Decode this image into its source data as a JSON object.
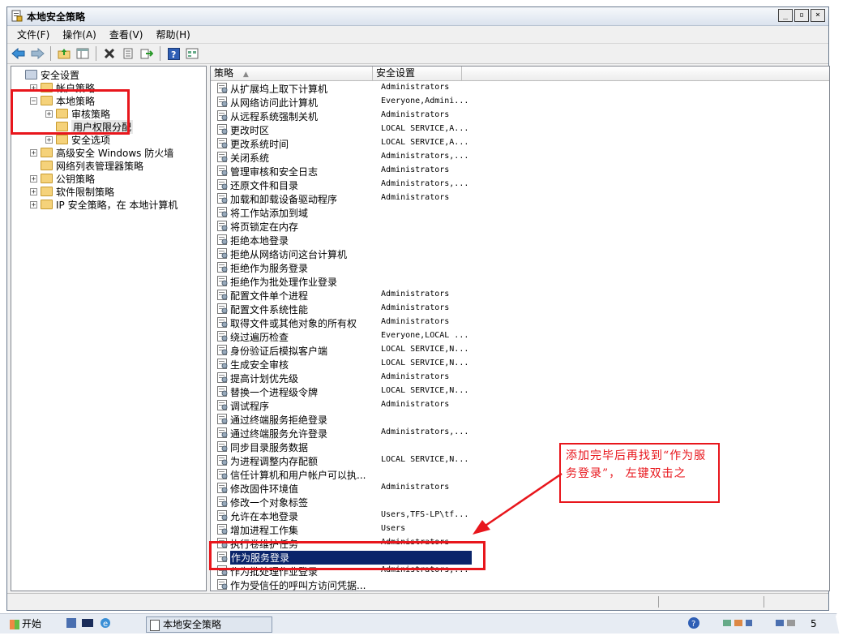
{
  "window": {
    "title": "本地安全策略"
  },
  "title_buttons": [
    "_",
    "▫",
    "×"
  ],
  "menu": [
    "文件(F)",
    "操作(A)",
    "查看(V)",
    "帮助(H)"
  ],
  "toolbar_icons": [
    "back-icon",
    "forward-icon",
    "up-folder-icon",
    "show-tree-icon",
    "delete-icon",
    "properties-icon",
    "export-icon",
    "help-icon",
    "view-icon"
  ],
  "tree": [
    {
      "label": "安全设置",
      "level": 0,
      "exp": ""
    },
    {
      "label": "帐户策略",
      "level": 1,
      "exp": "+"
    },
    {
      "label": "本地策略",
      "level": 1,
      "exp": "−"
    },
    {
      "label": "审核策略",
      "level": 2,
      "exp": "+"
    },
    {
      "label": "用户权限分配",
      "level": 2,
      "exp": ""
    },
    {
      "label": "安全选项",
      "level": 2,
      "exp": "+"
    },
    {
      "label": "高级安全 Windows 防火墙",
      "level": 1,
      "exp": "+"
    },
    {
      "label": "网络列表管理器策略",
      "level": 1,
      "exp": ""
    },
    {
      "label": "公钥策略",
      "level": 1,
      "exp": "+"
    },
    {
      "label": "软件限制策略",
      "level": 1,
      "exp": "+"
    },
    {
      "label": "IP 安全策略，在 本地计算机",
      "level": 1,
      "exp": "+"
    }
  ],
  "columns": [
    "策略",
    "安全设置"
  ],
  "policies": [
    {
      "name": "从扩展坞上取下计算机",
      "value": "Administrators"
    },
    {
      "name": "从网络访问此计算机",
      "value": "Everyone,Admini..."
    },
    {
      "name": "从远程系统强制关机",
      "value": "Administrators"
    },
    {
      "name": "更改时区",
      "value": "LOCAL SERVICE,A..."
    },
    {
      "name": "更改系统时间",
      "value": "LOCAL SERVICE,A..."
    },
    {
      "name": "关闭系统",
      "value": "Administrators,..."
    },
    {
      "name": "管理审核和安全日志",
      "value": "Administrators"
    },
    {
      "name": "还原文件和目录",
      "value": "Administrators,..."
    },
    {
      "name": "加载和卸载设备驱动程序",
      "value": "Administrators"
    },
    {
      "name": "将工作站添加到域",
      "value": ""
    },
    {
      "name": "将页锁定在内存",
      "value": ""
    },
    {
      "name": "拒绝本地登录",
      "value": ""
    },
    {
      "name": "拒绝从网络访问这台计算机",
      "value": ""
    },
    {
      "name": "拒绝作为服务登录",
      "value": ""
    },
    {
      "name": "拒绝作为批处理作业登录",
      "value": ""
    },
    {
      "name": "配置文件单个进程",
      "value": "Administrators"
    },
    {
      "name": "配置文件系统性能",
      "value": "Administrators"
    },
    {
      "name": "取得文件或其他对象的所有权",
      "value": "Administrators"
    },
    {
      "name": "绕过遍历检查",
      "value": "Everyone,LOCAL ..."
    },
    {
      "name": "身份验证后模拟客户端",
      "value": "LOCAL SERVICE,N..."
    },
    {
      "name": "生成安全审核",
      "value": "LOCAL SERVICE,N..."
    },
    {
      "name": "提高计划优先级",
      "value": "Administrators"
    },
    {
      "name": "替换一个进程级令牌",
      "value": "LOCAL SERVICE,N..."
    },
    {
      "name": "调试程序",
      "value": "Administrators"
    },
    {
      "name": "通过终端服务拒绝登录",
      "value": ""
    },
    {
      "name": "通过终端服务允许登录",
      "value": "Administrators,..."
    },
    {
      "name": "同步目录服务数据",
      "value": ""
    },
    {
      "name": "为进程调整内存配额",
      "value": "LOCAL SERVICE,N..."
    },
    {
      "name": "信任计算机和用户帐户可以执...",
      "value": ""
    },
    {
      "name": "修改固件环境值",
      "value": "Administrators"
    },
    {
      "name": "修改一个对象标签",
      "value": ""
    },
    {
      "name": "允许在本地登录",
      "value": "Users,TFS-LP\\tf..."
    },
    {
      "name": "增加进程工作集",
      "value": "Users"
    },
    {
      "name": "执行卷维护任务",
      "value": "Administrators"
    },
    {
      "name": "作为服务登录",
      "value": "",
      "selected": true
    },
    {
      "name": "作为批处理作业登录",
      "value": "Administrators,..."
    },
    {
      "name": "作为受信任的呼叫方访问凭据...",
      "value": ""
    }
  ],
  "annotation": {
    "text": "添加完毕后再找到“作为服务登录”， 左键双击之",
    "color": "#e8161c"
  },
  "taskbar": {
    "start": "开始",
    "window_item": "本地安全策略",
    "clock": "5"
  },
  "colors": {
    "selection": "#0a246a",
    "annotation_red": "#e8161c"
  }
}
